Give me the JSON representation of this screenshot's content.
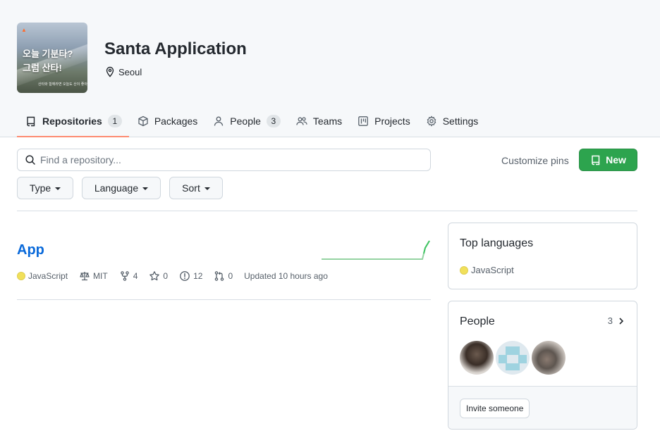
{
  "org": {
    "name": "Santa Application",
    "location": "Seoul",
    "avatar_text_line1": "오늘 기분타?",
    "avatar_text_line2": "그럼 산타!",
    "avatar_text_line3": "산타와 함께라면 오늘도 산이 좋아"
  },
  "tabs": [
    {
      "label": "Repositories",
      "counter": "1",
      "icon": "repo-icon"
    },
    {
      "label": "Packages",
      "icon": "package-icon"
    },
    {
      "label": "People",
      "counter": "3",
      "icon": "person-icon"
    },
    {
      "label": "Teams",
      "icon": "people-icon"
    },
    {
      "label": "Projects",
      "icon": "project-icon"
    },
    {
      "label": "Settings",
      "icon": "gear-icon"
    }
  ],
  "search": {
    "placeholder": "Find a repository..."
  },
  "customize_pins": "Customize pins",
  "new_button": "New",
  "filters": {
    "type": "Type",
    "language": "Language",
    "sort": "Sort"
  },
  "repo": {
    "name": "App",
    "language": "JavaScript",
    "language_color": "#f1e05a",
    "license": "MIT",
    "forks": "4",
    "stars": "0",
    "issues": "12",
    "pulls": "0",
    "updated": "Updated 10 hours ago"
  },
  "top_languages": {
    "title": "Top languages",
    "language": "JavaScript"
  },
  "people": {
    "title": "People",
    "count": "3",
    "invite": "Invite someone"
  },
  "colors": {
    "accent": "#0969da",
    "new_button": "#2da44e",
    "tab_underline": "#fd8c73"
  }
}
